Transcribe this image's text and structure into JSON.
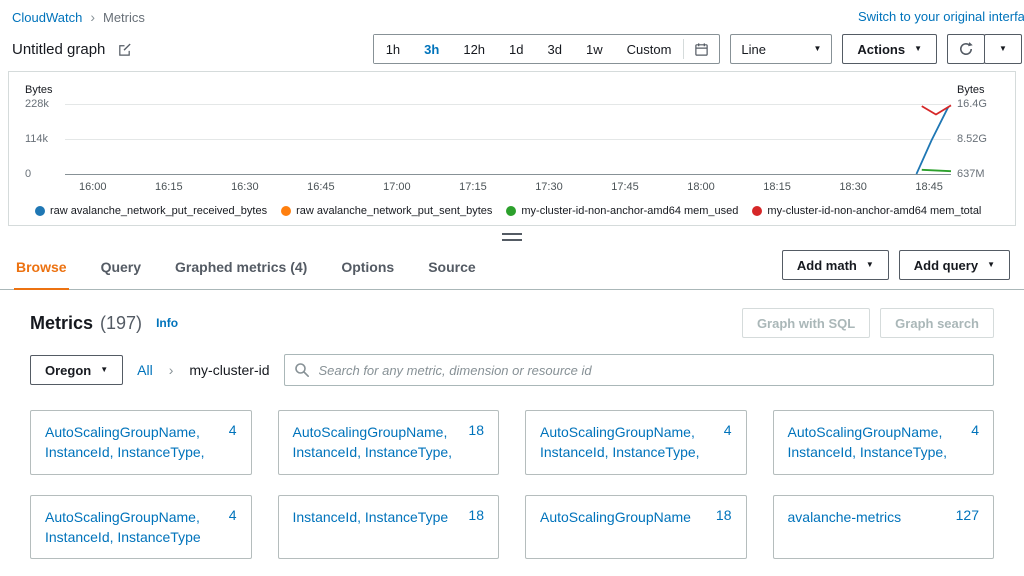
{
  "header": {
    "breadcrumb_root": "CloudWatch",
    "breadcrumb_current": "Metrics",
    "switch_link": "Switch to your original interface"
  },
  "title_bar": {
    "title": "Untitled graph",
    "time_ranges": [
      "1h",
      "3h",
      "12h",
      "1d",
      "3d",
      "1w"
    ],
    "custom_label": "Custom",
    "selected_range": "3h",
    "chart_type_select": "Line",
    "actions_label": "Actions"
  },
  "chart_data": {
    "type": "line",
    "left_axis": {
      "label": "Bytes",
      "ticks": [
        "228k",
        "114k",
        "0"
      ]
    },
    "right_axis": {
      "label": "Bytes",
      "ticks": [
        "16.4G",
        "8.52G",
        "637M"
      ]
    },
    "x_ticks": [
      "16:00",
      "16:15",
      "16:30",
      "16:45",
      "17:00",
      "17:15",
      "17:30",
      "17:45",
      "18:00",
      "18:15",
      "18:30",
      "18:45"
    ],
    "series": [
      {
        "name": "raw avalanche_network_put_received_bytes",
        "color": "#1f77b4",
        "axis": "left",
        "points": [
          [
            961,
            100
          ],
          [
            978,
            52
          ],
          [
            997,
            4
          ]
        ]
      },
      {
        "name": "raw avalanche_network_put_sent_bytes",
        "color": "#ff7f0e",
        "axis": "left",
        "points": []
      },
      {
        "name": "my-cluster-id-non-anchor-amd64 mem_used",
        "color": "#2ca02c",
        "axis": "right",
        "points": [
          [
            967,
            94
          ],
          [
            1000,
            96
          ]
        ]
      },
      {
        "name": "my-cluster-id-non-anchor-amd64 mem_total",
        "color": "#d62728",
        "axis": "right",
        "points": [
          [
            967,
            3
          ],
          [
            983,
            15
          ],
          [
            1000,
            2
          ]
        ]
      }
    ]
  },
  "tabs": {
    "items": [
      "Browse",
      "Query",
      "Graphed metrics (4)",
      "Options",
      "Source"
    ],
    "active": "Browse",
    "add_math": "Add math",
    "add_query": "Add query"
  },
  "metrics": {
    "title": "Metrics",
    "count": "(197)",
    "info_link": "Info",
    "graph_with_sql": "Graph with SQL",
    "graph_search": "Graph search",
    "region": "Oregon",
    "filter_all": "All",
    "filter_current": "my-cluster-id",
    "search_placeholder": "Search for any metric, dimension or resource id",
    "cards": [
      {
        "label": "AutoScalingGroupName, InstanceId, InstanceType,",
        "count": "4"
      },
      {
        "label": "AutoScalingGroupName, InstanceId, InstanceType,",
        "count": "18"
      },
      {
        "label": "AutoScalingGroupName, InstanceId, InstanceType,",
        "count": "4"
      },
      {
        "label": "AutoScalingGroupName, InstanceId, InstanceType,",
        "count": "4"
      },
      {
        "label": "AutoScalingGroupName, InstanceId, InstanceType",
        "count": "4"
      },
      {
        "label": "InstanceId, InstanceType",
        "count": "18"
      },
      {
        "label": "AutoScalingGroupName",
        "count": "18"
      },
      {
        "label": "avalanche-metrics",
        "count": "127"
      }
    ]
  }
}
